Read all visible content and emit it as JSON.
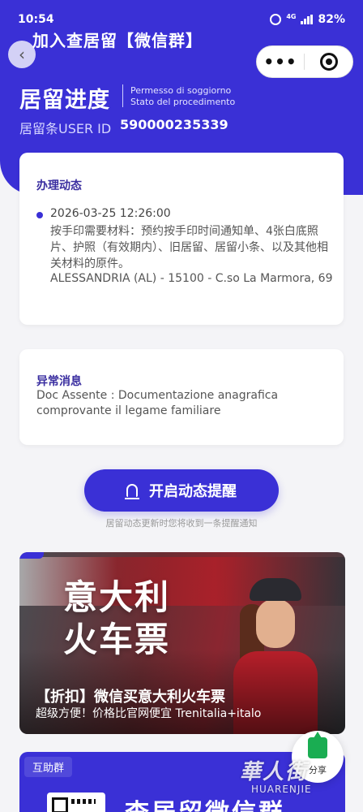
{
  "status_bar": {
    "time": "10:54",
    "network": "4G",
    "battery": "82%"
  },
  "mini_program": {
    "title": "加入查居留【微信群】",
    "menu_dots": "•••"
  },
  "header": {
    "title": "居留进度",
    "subtitle_line1": "Permesso di soggiorno",
    "subtitle_line2": "Stato del procedimento",
    "id_label": "居留条USER ID",
    "id_value": "590000235339"
  },
  "activity_card": {
    "title": "办理动态",
    "entries": [
      {
        "datetime": "2026-03-25 12:26:00",
        "text": "按手印需要材料：预约按手印时间通知单、4张白底照片、护照（有效期内）、旧居留、居留小条、以及其他相关材料的原件。",
        "address": "ALESSANDRIA (AL) - 15100 - C.so La Marmora, 69"
      }
    ]
  },
  "error_card": {
    "title": "异常消息",
    "text": "Doc Assente : Documentazione anagrafica comprovante il legame familiare"
  },
  "notify": {
    "button_label": "开启动态提醒",
    "hint": "居留动态更新时您将收到一条提醒通知"
  },
  "banner": {
    "big_line1": "意大利",
    "big_line2": "火车票",
    "title": "【折扣】微信买意大利火车票",
    "subtitle": "超级方便！价格比官网便宜 Trenitalia+italo"
  },
  "group_card": {
    "tag": "互助群",
    "title": "查居留微信群"
  },
  "share": {
    "label": "分享"
  },
  "watermark": {
    "cn": "華人街",
    "en": "HUARENJIE"
  },
  "colors": {
    "primary": "#3a30d6",
    "card_title": "#3a2ea0",
    "share_green": "#1aad52"
  }
}
